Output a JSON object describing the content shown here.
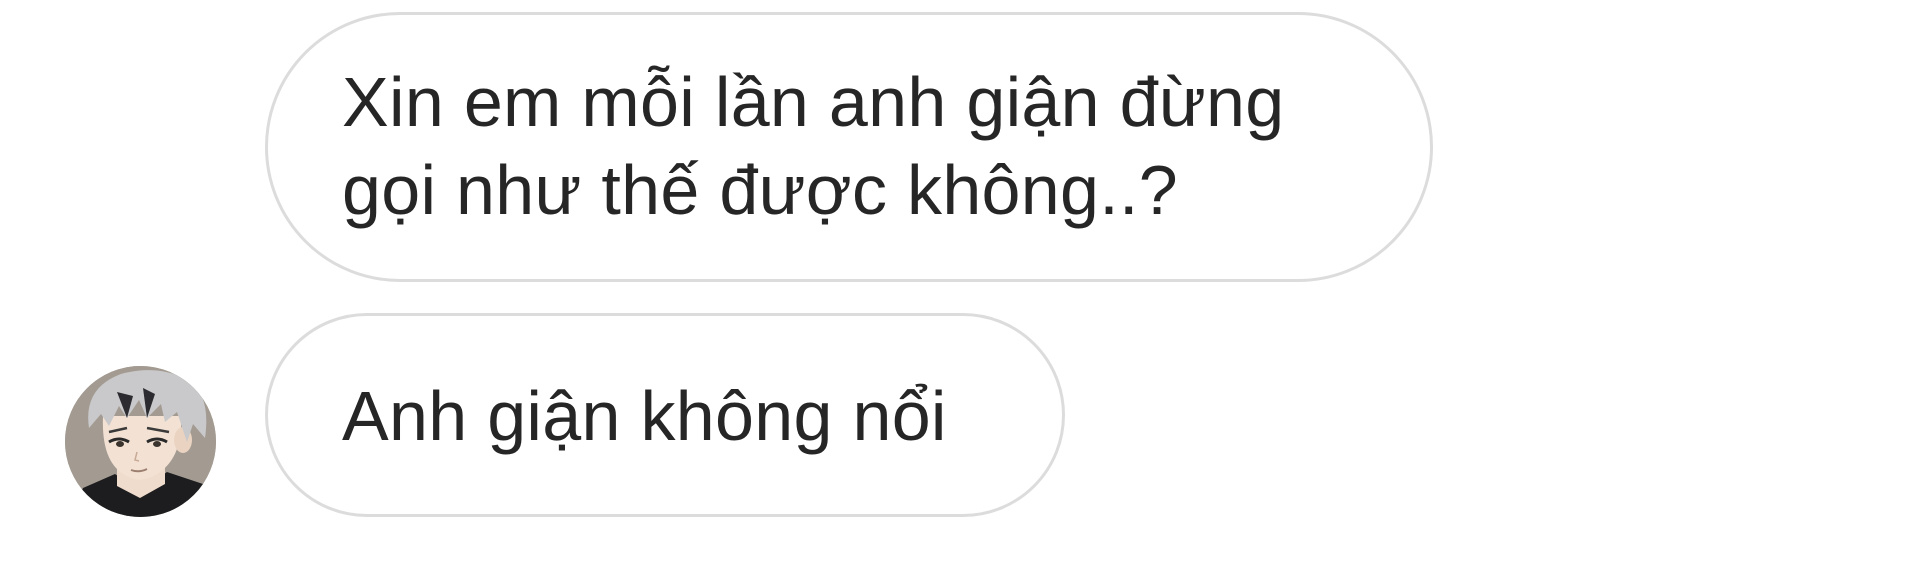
{
  "messages": [
    {
      "lines": [
        "Xin em mỗi lần anh giận đừng",
        "gọi như thế được không..?"
      ]
    },
    {
      "lines": [
        "Anh giận không nổi"
      ]
    }
  ]
}
